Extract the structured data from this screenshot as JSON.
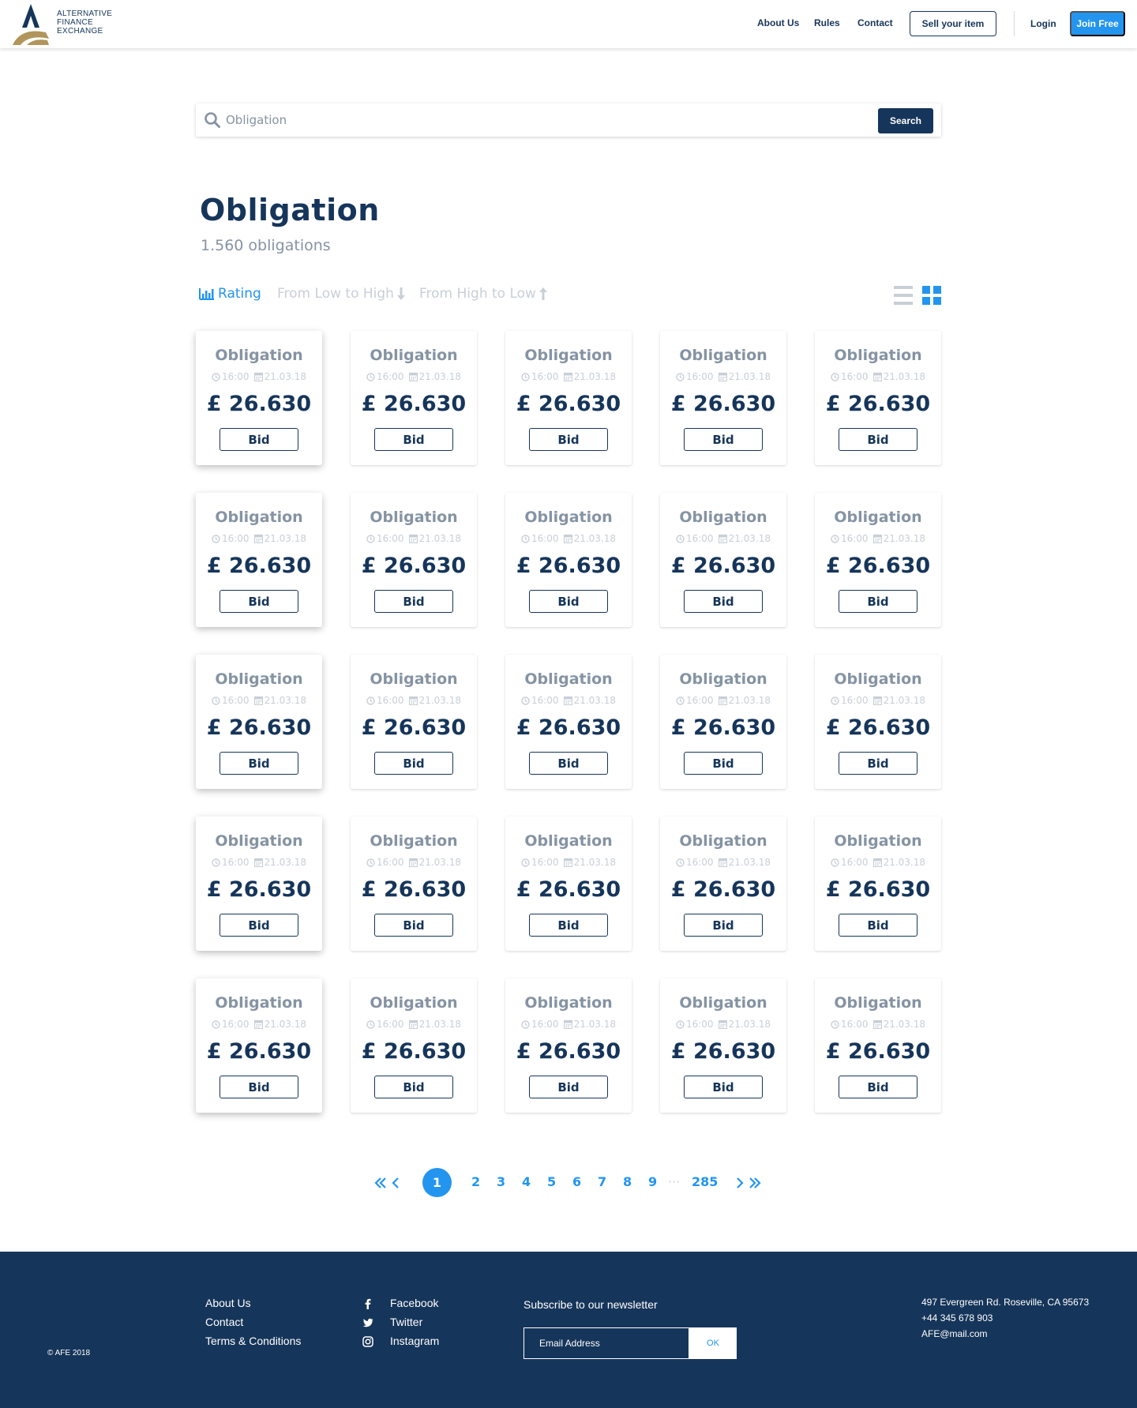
{
  "brand": {
    "logo_lines": [
      "ALTERNATIVE",
      "FINANCE",
      "EXCHANGE"
    ],
    "colors": {
      "navy": "#16355a",
      "gold": "#b1955a",
      "accent": "#2395ef"
    }
  },
  "nav": {
    "about": "About Us",
    "rules": "Rules",
    "contact": "Contact",
    "sell": "Sell your item",
    "login": "Login",
    "join": "Join Free"
  },
  "search": {
    "placeholder": "Obligation",
    "button": "Search",
    "icon": "search-icon"
  },
  "page": {
    "title": "Obligation",
    "count": "1.560 obligations"
  },
  "sort": {
    "rating": "Rating",
    "low_high": "From Low to High",
    "high_low": "From High to Low",
    "active": "rating",
    "view": "grid"
  },
  "cards": [
    {
      "title": "Obligation",
      "time": "16:00",
      "date": "21.03.18",
      "price": "£ 26.630",
      "button": "Bid"
    },
    {
      "title": "Obligation",
      "time": "16:00",
      "date": "21.03.18",
      "price": "£ 26.630",
      "button": "Bid"
    },
    {
      "title": "Obligation",
      "time": "16:00",
      "date": "21.03.18",
      "price": "£ 26.630",
      "button": "Bid"
    },
    {
      "title": "Obligation",
      "time": "16:00",
      "date": "21.03.18",
      "price": "£ 26.630",
      "button": "Bid"
    },
    {
      "title": "Obligation",
      "time": "16:00",
      "date": "21.03.18",
      "price": "£ 26.630",
      "button": "Bid"
    },
    {
      "title": "Obligation",
      "time": "16:00",
      "date": "21.03.18",
      "price": "£ 26.630",
      "button": "Bid"
    },
    {
      "title": "Obligation",
      "time": "16:00",
      "date": "21.03.18",
      "price": "£ 26.630",
      "button": "Bid"
    },
    {
      "title": "Obligation",
      "time": "16:00",
      "date": "21.03.18",
      "price": "£ 26.630",
      "button": "Bid"
    },
    {
      "title": "Obligation",
      "time": "16:00",
      "date": "21.03.18",
      "price": "£ 26.630",
      "button": "Bid"
    },
    {
      "title": "Obligation",
      "time": "16:00",
      "date": "21.03.18",
      "price": "£ 26.630",
      "button": "Bid"
    },
    {
      "title": "Obligation",
      "time": "16:00",
      "date": "21.03.18",
      "price": "£ 26.630",
      "button": "Bid"
    },
    {
      "title": "Obligation",
      "time": "16:00",
      "date": "21.03.18",
      "price": "£ 26.630",
      "button": "Bid"
    },
    {
      "title": "Obligation",
      "time": "16:00",
      "date": "21.03.18",
      "price": "£ 26.630",
      "button": "Bid"
    },
    {
      "title": "Obligation",
      "time": "16:00",
      "date": "21.03.18",
      "price": "£ 26.630",
      "button": "Bid"
    },
    {
      "title": "Obligation",
      "time": "16:00",
      "date": "21.03.18",
      "price": "£ 26.630",
      "button": "Bid"
    },
    {
      "title": "Obligation",
      "time": "16:00",
      "date": "21.03.18",
      "price": "£ 26.630",
      "button": "Bid"
    },
    {
      "title": "Obligation",
      "time": "16:00",
      "date": "21.03.18",
      "price": "£ 26.630",
      "button": "Bid"
    },
    {
      "title": "Obligation",
      "time": "16:00",
      "date": "21.03.18",
      "price": "£ 26.630",
      "button": "Bid"
    },
    {
      "title": "Obligation",
      "time": "16:00",
      "date": "21.03.18",
      "price": "£ 26.630",
      "button": "Bid"
    },
    {
      "title": "Obligation",
      "time": "16:00",
      "date": "21.03.18",
      "price": "£ 26.630",
      "button": "Bid"
    },
    {
      "title": "Obligation",
      "time": "16:00",
      "date": "21.03.18",
      "price": "£ 26.630",
      "button": "Bid"
    },
    {
      "title": "Obligation",
      "time": "16:00",
      "date": "21.03.18",
      "price": "£ 26.630",
      "button": "Bid"
    },
    {
      "title": "Obligation",
      "time": "16:00",
      "date": "21.03.18",
      "price": "£ 26.630",
      "button": "Bid"
    },
    {
      "title": "Obligation",
      "time": "16:00",
      "date": "21.03.18",
      "price": "£ 26.630",
      "button": "Bid"
    },
    {
      "title": "Obligation",
      "time": "16:00",
      "date": "21.03.18",
      "price": "£ 26.630",
      "button": "Bid"
    }
  ],
  "pagination": {
    "current": "1",
    "pages": [
      "2",
      "3",
      "4",
      "5",
      "6",
      "7",
      "8",
      "9"
    ],
    "dots": "···",
    "last": "285"
  },
  "footer": {
    "links": [
      "About Us",
      "Contact",
      "Terms & Conditions"
    ],
    "social": [
      {
        "label": "Facebook",
        "icon": "facebook-icon"
      },
      {
        "label": "Twitter",
        "icon": "twitter-icon"
      },
      {
        "label": "Instagram",
        "icon": "instagram-icon"
      }
    ],
    "newsletter_title": "Subscribe to our newsletter",
    "email_placeholder": "Email Address",
    "ok": "OK",
    "address": "497 Evergreen Rd. Roseville, CA 95673",
    "phone": "+44 345 678 903",
    "email": "AFE@mail.com",
    "copyright": "© AFE 2018"
  }
}
